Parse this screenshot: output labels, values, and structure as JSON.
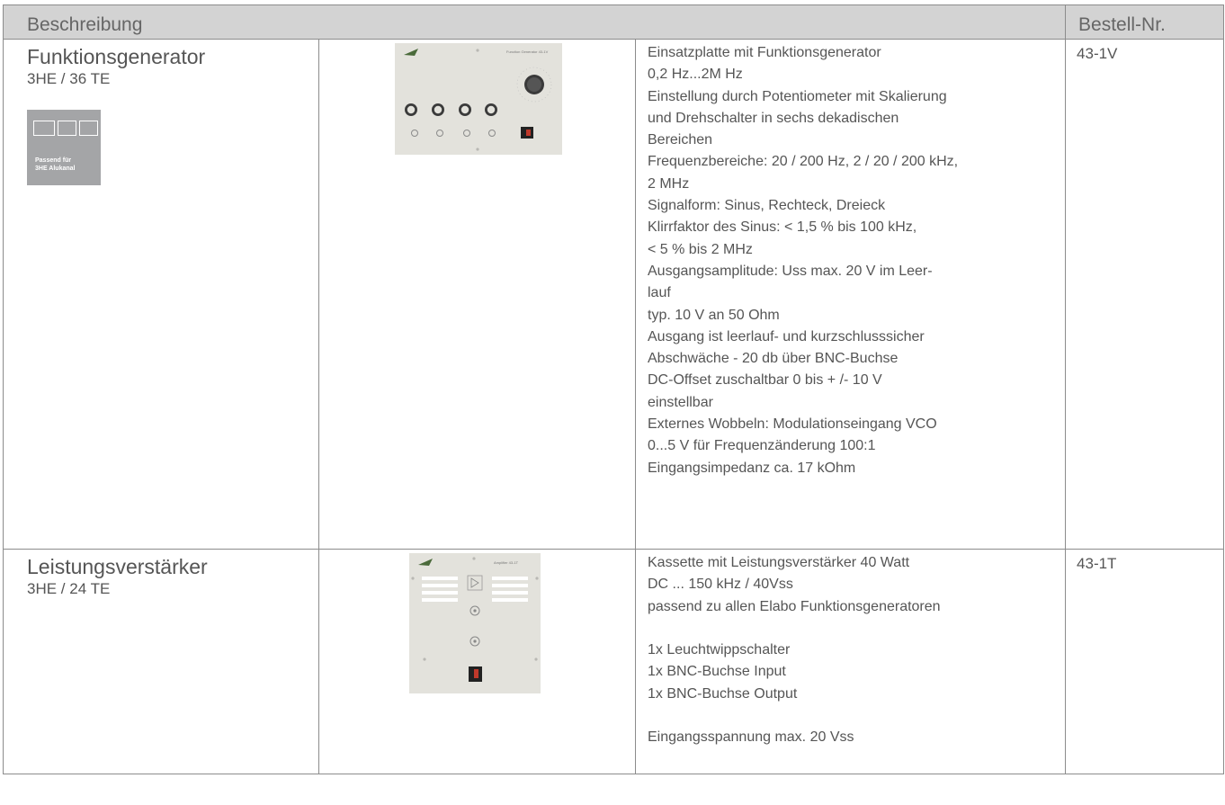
{
  "header": {
    "description_label": "Beschreibung",
    "order_no_label": "Bestell-Nr."
  },
  "products": [
    {
      "name": "Funktionsgenerator",
      "size": "3HE / 36 TE",
      "badge": {
        "line1": "Passend für",
        "line2": "3HE Alukanal"
      },
      "panel_label": "Function Generator 43-1V",
      "order_no": "43-1V",
      "description": [
        "Einsatzplatte mit Funktionsgenerator",
        "0,2 Hz...2M Hz",
        "Einstellung durch Potentiometer mit Skalierung",
        "und Drehschalter in sechs dekadischen",
        "Bereichen",
        "Frequenzbereiche: 20 / 200 Hz, 2 / 20 / 200 kHz,",
        "2 MHz",
        "Signalform: Sinus, Rechteck, Dreieck",
        "Klirrfaktor des Sinus:   < 1,5 % bis 100 kHz,",
        "< 5 % bis 2 MHz",
        "Ausgangsamplitude:   Uss max. 20  V im Leer-",
        "lauf",
        "typ. 10 V an 50 Ohm",
        "Ausgang ist leerlauf- und kurzschlusssicher",
        "Abschwäche  - 20 db über BNC-Buchse",
        "DC-Offset zuschaltbar   0 bis + /- 10 V",
        "einstellbar",
        "Externes Wobbeln: Modulationseingang VCO",
        "0...5 V für Frequenzänderung 100:1",
        "Eingangsimpedanz ca. 17 kOhm"
      ]
    },
    {
      "name": "Leistungsverstärker",
      "size": "3HE / 24 TE",
      "panel_label": "Amplifier 43-1T",
      "order_no": "43-1T",
      "description": [
        "Kassette mit Leistungsverstärker 40 Watt",
        "DC ... 150 kHz / 40Vss",
        "passend zu allen Elabo Funktionsgeneratoren",
        "",
        "1x Leuchtwippschalter",
        "1x BNC-Buchse Input",
        "1x BNC-Buchse Output",
        "",
        "Eingangsspannung max. 20 Vss"
      ]
    }
  ],
  "colors": {
    "header_bg": "#d3d3d3",
    "border": "#8c8c8c",
    "text": "#555555",
    "badge_bg": "#a4a5a7",
    "panel_bg": "#e3e2dc"
  }
}
